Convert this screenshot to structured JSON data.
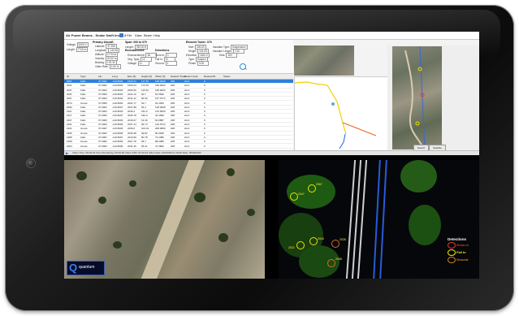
{
  "app": {
    "window_title": "Air Power Beams - Snake Swift Insert 2",
    "menu": [
      "File",
      "Data",
      "Beam",
      "Help"
    ],
    "summary": {
      "voltage_label": "Voltage:",
      "voltage_value": "2000 V",
      "length_label": "Length:",
      "length_value": "7740 m",
      "primary_group": "Primary Aircraft",
      "primary": [
        {
          "k": "Latitude:",
          "v": "37.900"
        },
        {
          "k": "Longitude:",
          "v": "-119.81"
        },
        {
          "k": "Altitude:",
          "v": "1770.04"
        },
        {
          "k": "Velocity:",
          "v": "20.00 m"
        },
        {
          "k": "Bearing:",
          "v": "176.30"
        },
        {
          "k": "Video Rate:",
          "v": "1:00 m"
        }
      ],
      "span_group": "Span: 000 to 070",
      "span_length": {
        "k": "Length:",
        "v": "789.00 ft"
      },
      "encroach_group": "Encroachment",
      "encroach": [
        {
          "k": "Encroachment:",
          "v": "36"
        },
        {
          "k": "Veg. Type:",
          "v": "12"
        },
        {
          "k": "Voltage:",
          "v": "11"
        }
      ],
      "detections_group": "Detections",
      "detections": [
        {
          "k": "Grow In:",
          "v": "1"
        },
        {
          "k": "Fall In:",
          "v": "11"
        },
        {
          "k": "Ground:",
          "v": "1"
        }
      ],
      "element_group": "Element Tower: 070",
      "element": [
        {
          "k": "Size:",
          "v": "200.00"
        },
        {
          "k": "Height:",
          "v": "141.00"
        },
        {
          "k": "Elevation:",
          "v": "1520.0"
        },
        {
          "k": "Type:",
          "v": "Suspen"
        },
        {
          "k": "Phase:",
          "v": "3.00"
        }
      ],
      "insulator": [
        {
          "k": "Insulator Type:",
          "v": "Suspension"
        },
        {
          "k": "Insulator Length:",
          "v": "7.00"
        },
        {
          "k": "Sets:",
          "v": "100"
        }
      ]
    },
    "table": {
      "headers": [
        "ID",
        "Type",
        "Lat",
        "Long",
        "Elev (ft)",
        "Height (ft)",
        "Offset (ft)",
        "Nearest Tower",
        "Detect Code",
        "Reason/ID",
        "Status"
      ],
      "rows": [
        [
          "0001",
          "Falls",
          "37.9001",
          "-119.8093",
          "1520.47",
          "127.87",
          "158.0008",
          "208",
          "HCA",
          "0",
          ""
        ],
        [
          "2031",
          "Falls",
          "37.9002",
          "-119.8093",
          "1593.04",
          "170.87",
          "158.0000",
          "208",
          "HCA",
          "0",
          ""
        ],
        [
          "2047",
          "Falls",
          "37.9004",
          "-119.8093",
          "2000.06",
          "115.62",
          "158.0000",
          "208",
          "HCA",
          "0",
          ""
        ],
        [
          "2061",
          "Falls",
          "37.9005",
          "-119.8094",
          "2011.10",
          "60.7",
          "64.5696",
          "208",
          "HCA",
          "0",
          ""
        ],
        [
          "2067",
          "Falls",
          "37.9004",
          "-119.8093",
          "2011.12",
          "96.99",
          "157.9774",
          "208",
          "HCA",
          "0",
          ""
        ],
        [
          "2074",
          "Grows",
          "37.9006",
          "-119.8092",
          "2041.77",
          "52.7",
          "64.4025",
          "208",
          "HCA",
          "0",
          ""
        ],
        [
          "2090",
          "Falls",
          "37.9001",
          "-119.8097",
          "2037.98",
          "96.4",
          "128.0608",
          "208",
          "HCA",
          "0",
          ""
        ],
        [
          "2111",
          "Falls",
          "37.9004",
          "-119.8093",
          "2036.2",
          "181.6",
          "133.9000",
          "208",
          "HCA",
          "0",
          ""
        ],
        [
          "2117",
          "Falls",
          "37.9006",
          "-119.8097",
          "2025.78",
          "182.0",
          "40.4996",
          "208",
          "HCA",
          "0",
          ""
        ],
        [
          "2167",
          "Falls",
          "37.9003",
          "-119.8093",
          "2016.07",
          "61.39",
          "60.0887",
          "208",
          "HCA",
          "0",
          ""
        ],
        [
          "2201",
          "Falls",
          "37.9004",
          "-119.8096",
          "2037.14",
          "96.73",
          "140.9713",
          "208",
          "HCA",
          "0",
          ""
        ],
        [
          "2221",
          "Grows",
          "37.9007",
          "-119.8093",
          "2030.6",
          "100.91",
          "268.0896",
          "208",
          "HCA",
          "0",
          ""
        ],
        [
          "1966",
          "Grows",
          "37.9002",
          "-119.8095",
          "2030.38",
          "99.82",
          "80.0069",
          "208",
          "HCA",
          "0",
          ""
        ],
        [
          "1989",
          "Falls",
          "37.9007",
          "-119.8097",
          "2010.99",
          "80.78",
          "74.2086",
          "208",
          "HCA",
          "0",
          ""
        ],
        [
          "1999",
          "Grows",
          "37.9002",
          "-119.8096",
          "2027.78",
          "68.7",
          "88.2086",
          "208",
          "HCA",
          "0",
          ""
        ],
        [
          "2004",
          "Grows",
          "37.9003",
          "-119.8099",
          "2031.25",
          "65.21",
          "47.3800",
          "208",
          "HCA",
          "0",
          ""
        ]
      ]
    },
    "status_bar": "Video Time: 00:04:23   Time Remaining: 00:00:00   Video GMT: 22:15:43   Video Date: 06/24/2012   LiDAR Date: 06/25/2012",
    "map_buttons": [
      "Search",
      "Satellite"
    ]
  },
  "logo_text": "quantum",
  "right_labels": [
    "2047",
    "2067",
    "2044",
    "2026",
    "2098",
    "2021"
  ],
  "legend": {
    "title": "Detections",
    "items": [
      {
        "label": "Grow In",
        "color": "#e33a2a"
      },
      {
        "label": "Fall In",
        "color": "#f3f000"
      },
      {
        "label": "Ground",
        "color": "#d4801c"
      }
    ]
  }
}
